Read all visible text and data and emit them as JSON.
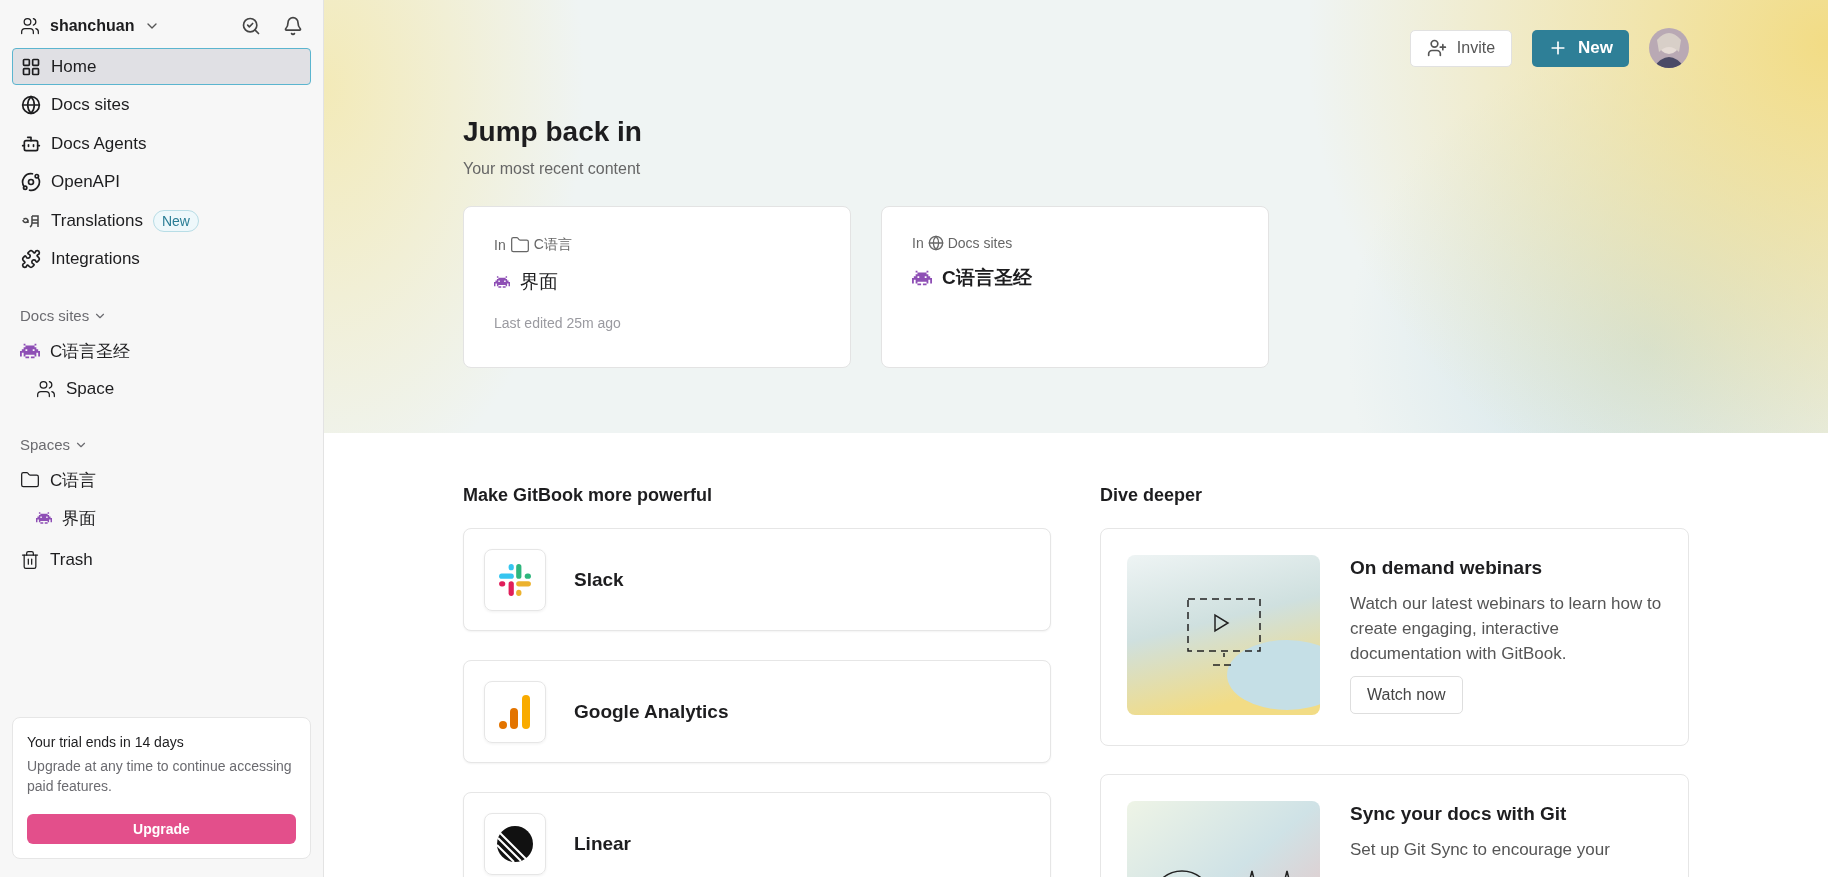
{
  "workspace": {
    "name": "shanchuan"
  },
  "sidebar": {
    "nav": [
      {
        "label": "Home",
        "selected": true
      },
      {
        "label": "Docs sites",
        "selected": false
      },
      {
        "label": "Docs Agents",
        "selected": false
      },
      {
        "label": "OpenAPI",
        "selected": false
      },
      {
        "label": "Translations",
        "selected": false,
        "badge": "New"
      },
      {
        "label": "Integrations",
        "selected": false
      }
    ],
    "sections": [
      {
        "title": "Docs sites",
        "items": [
          {
            "label": "C语言圣经",
            "kind": "site",
            "children": [
              {
                "label": "Space",
                "kind": "space"
              }
            ]
          }
        ]
      },
      {
        "title": "Spaces",
        "items": [
          {
            "label": "C语言",
            "kind": "folder",
            "children": [
              {
                "label": "界面",
                "kind": "page"
              }
            ]
          }
        ]
      }
    ],
    "trash": "Trash",
    "trial": {
      "title": "Your trial ends in 14 days",
      "text": "Upgrade at any time to continue accessing paid features.",
      "button": "Upgrade"
    }
  },
  "header": {
    "invite": "Invite",
    "new": "New"
  },
  "recent": {
    "title": "Jump back in",
    "subtitle": "Your most recent content",
    "cards": [
      {
        "prefix": "In",
        "location": {
          "label": "C语言",
          "kind": "folder"
        },
        "title": "界面",
        "kind": "page",
        "meta": "Last edited 25m ago"
      },
      {
        "prefix": "In",
        "location": {
          "label": "Docs sites",
          "kind": "sites"
        },
        "title": "C语言圣经",
        "kind": "site"
      }
    ]
  },
  "integrations": {
    "title": "Make GitBook more powerful",
    "items": [
      {
        "name": "Slack"
      },
      {
        "name": "Google Analytics"
      },
      {
        "name": "Linear"
      }
    ]
  },
  "resources": {
    "title": "Dive deeper",
    "items": [
      {
        "title": "On demand webinars",
        "text": "Watch our latest webinars to learn how to create engaging, interactive documentation with GitBook.",
        "action": "Watch now"
      },
      {
        "title": "Sync your docs with Git",
        "text": "Set up Git Sync to encourage your"
      }
    ]
  }
}
